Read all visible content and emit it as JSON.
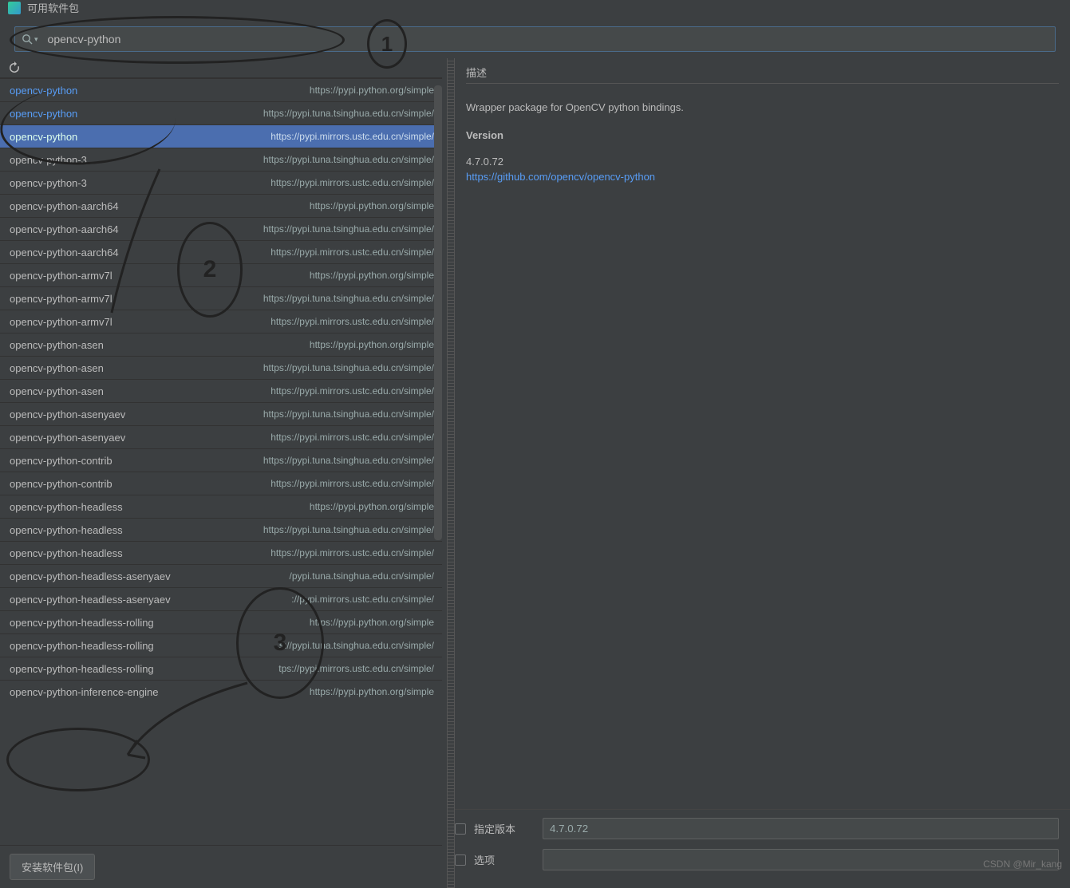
{
  "window_title": "可用软件包",
  "search": {
    "value": "opencv-python"
  },
  "refresh_icon": "refresh",
  "packages": [
    {
      "name": "opencv-python",
      "src": "https://pypi.python.org/simple",
      "link": true
    },
    {
      "name": "opencv-python",
      "src": "https://pypi.tuna.tsinghua.edu.cn/simple/",
      "link": true
    },
    {
      "name": "opencv-python",
      "src": "https://pypi.mirrors.ustc.edu.cn/simple/",
      "link": true,
      "selected": true
    },
    {
      "name": "opencv-python-3",
      "src": "https://pypi.tuna.tsinghua.edu.cn/simple/"
    },
    {
      "name": "opencv-python-3",
      "src": "https://pypi.mirrors.ustc.edu.cn/simple/"
    },
    {
      "name": "opencv-python-aarch64",
      "src": "https://pypi.python.org/simple"
    },
    {
      "name": "opencv-python-aarch64",
      "src": "https://pypi.tuna.tsinghua.edu.cn/simple/"
    },
    {
      "name": "opencv-python-aarch64",
      "src": "https://pypi.mirrors.ustc.edu.cn/simple/"
    },
    {
      "name": "opencv-python-armv7l",
      "src": "https://pypi.python.org/simple"
    },
    {
      "name": "opencv-python-armv7l",
      "src": "https://pypi.tuna.tsinghua.edu.cn/simple/"
    },
    {
      "name": "opencv-python-armv7l",
      "src": "https://pypi.mirrors.ustc.edu.cn/simple/"
    },
    {
      "name": "opencv-python-asen",
      "src": "https://pypi.python.org/simple"
    },
    {
      "name": "opencv-python-asen",
      "src": "https://pypi.tuna.tsinghua.edu.cn/simple/"
    },
    {
      "name": "opencv-python-asen",
      "src": "https://pypi.mirrors.ustc.edu.cn/simple/"
    },
    {
      "name": "opencv-python-asenyaev",
      "src": "https://pypi.tuna.tsinghua.edu.cn/simple/"
    },
    {
      "name": "opencv-python-asenyaev",
      "src": "https://pypi.mirrors.ustc.edu.cn/simple/"
    },
    {
      "name": "opencv-python-contrib",
      "src": "https://pypi.tuna.tsinghua.edu.cn/simple/"
    },
    {
      "name": "opencv-python-contrib",
      "src": "https://pypi.mirrors.ustc.edu.cn/simple/"
    },
    {
      "name": "opencv-python-headless",
      "src": "https://pypi.python.org/simple"
    },
    {
      "name": "opencv-python-headless",
      "src": "https://pypi.tuna.tsinghua.edu.cn/simple/"
    },
    {
      "name": "opencv-python-headless",
      "src": "https://pypi.mirrors.ustc.edu.cn/simple/"
    },
    {
      "name": "opencv-python-headless-asenyaev",
      "src": "/pypi.tuna.tsinghua.edu.cn/simple/"
    },
    {
      "name": "opencv-python-headless-asenyaev",
      "src": "://pypi.mirrors.ustc.edu.cn/simple/"
    },
    {
      "name": "opencv-python-headless-rolling",
      "src": "https://pypi.python.org/simple"
    },
    {
      "name": "opencv-python-headless-rolling",
      "src": "s://pypi.tuna.tsinghua.edu.cn/simple/"
    },
    {
      "name": "opencv-python-headless-rolling",
      "src": "tps://pypi.mirrors.ustc.edu.cn/simple/"
    },
    {
      "name": "opencv-python-inference-engine",
      "src": "https://pypi.python.org/simple"
    }
  ],
  "install_button": "安装软件包(I)",
  "detail": {
    "section_title": "描述",
    "description": "Wrapper package for OpenCV python bindings.",
    "version_label": "Version",
    "version_value": "4.7.0.72",
    "homepage": "https://github.com/opencv/opencv-python"
  },
  "form": {
    "specify_version_label": "指定版本",
    "specify_version_value": "4.7.0.72",
    "options_label": "选项",
    "options_value": ""
  },
  "watermark": "CSDN @Mir_kang",
  "annotations": {
    "n1": "1",
    "n2": "2",
    "n3": "3"
  }
}
